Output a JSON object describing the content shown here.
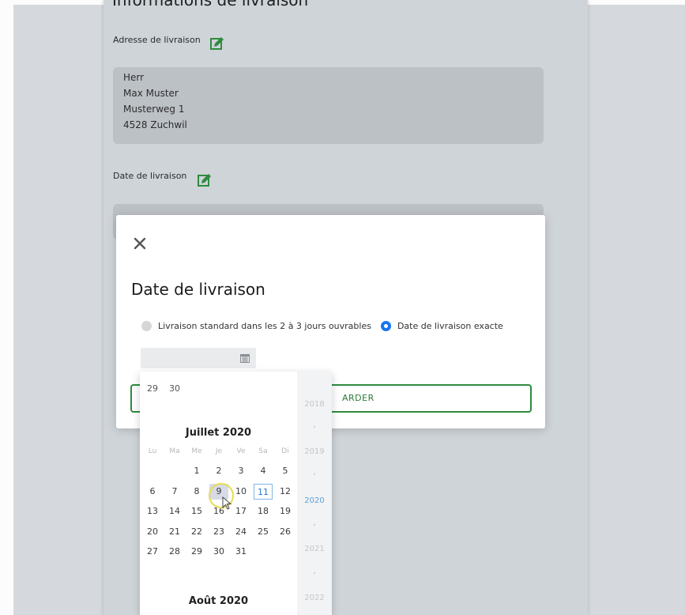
{
  "section": {
    "title": "Informations de livraison"
  },
  "address": {
    "label": "Adresse de livraison",
    "lines": [
      "Herr",
      "Max Muster",
      "Musterweg 1",
      "4528 Zuchwil"
    ]
  },
  "delivery_date": {
    "label": "Date de livraison"
  },
  "modal": {
    "title": "Date de livraison",
    "option_standard": "Livraison standard dans les 2 à 3 jours ouvrables",
    "option_exact": "Date de livraison exacte",
    "selected_option": "exact",
    "date_value": "",
    "save_label": "ARDER"
  },
  "calendar": {
    "prev_tail": [
      "29",
      "30"
    ],
    "weekdays": [
      "Lu",
      "Ma",
      "Me",
      "Je",
      "Ve",
      "Sa",
      "Di"
    ],
    "month1": {
      "title": "Juillet 2020",
      "weeks": [
        [
          "",
          "",
          "1",
          "2",
          "3",
          "4",
          "5"
        ],
        [
          "6",
          "7",
          "8",
          "9",
          "10",
          "11",
          "12"
        ],
        [
          "13",
          "14",
          "15",
          "16",
          "17",
          "18",
          "19"
        ],
        [
          "20",
          "21",
          "22",
          "23",
          "24",
          "25",
          "26"
        ],
        [
          "27",
          "28",
          "29",
          "30",
          "31",
          "",
          ""
        ]
      ],
      "today": "11",
      "hovered": "9"
    },
    "month2": {
      "title": "Août 2020"
    },
    "years": [
      "2018",
      "2019",
      "2020",
      "2021",
      "2022"
    ],
    "current_year": "2020"
  },
  "colors": {
    "accent_green": "#2e8b3e",
    "radio_blue": "#1877f2",
    "today_blue": "#1f7ad1"
  }
}
